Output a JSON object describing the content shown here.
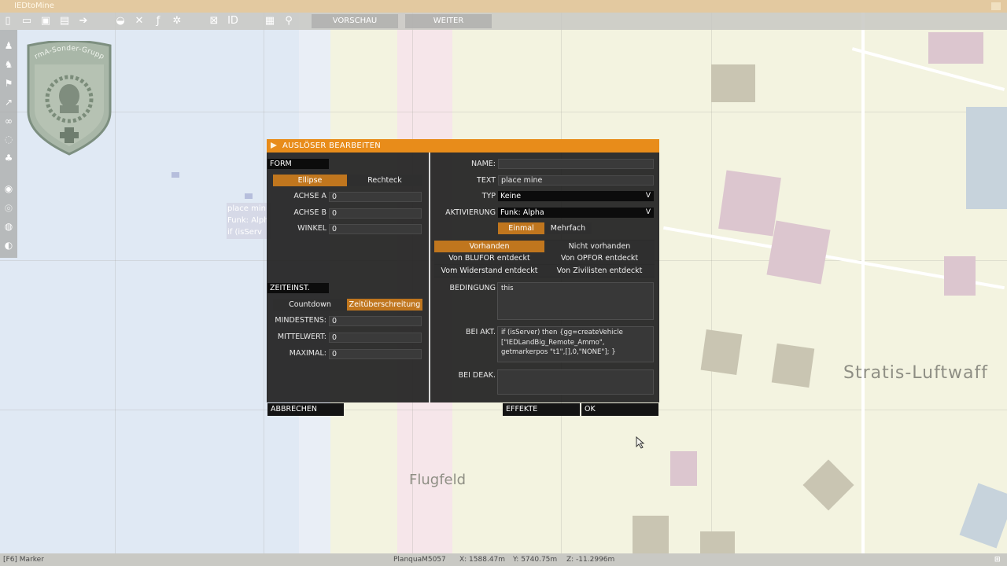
{
  "window": {
    "title": "IEDtoMine"
  },
  "toolbar": {
    "icons": [
      "new-file-icon",
      "open-folder-icon",
      "save-icon",
      "save-as-icon",
      "export-icon",
      "vehicle-icon",
      "tools-icon",
      "function-icon",
      "gear-icon",
      "grid-icon",
      "id-icon",
      "window-icon",
      "link-icon"
    ],
    "preview_label": "VORSCHAU",
    "continue_label": "WEITER"
  },
  "sidebar": {
    "icons": [
      "unit-icon",
      "group-icon",
      "flag-icon",
      "waypoint-icon",
      "link-icon",
      "trigger-icon",
      "vehicle-group-icon",
      "marker-icon",
      "sensor-icon",
      "module-icon",
      "module-alt-icon"
    ]
  },
  "emblem": {
    "text": "ArmA-Sonder-Gruppe"
  },
  "map": {
    "labels": {
      "airfield": "Flugfeld",
      "airbase": "Stratis-Luftwaff"
    },
    "marker_lines": [
      "place min",
      "Funk: Alph",
      "if (isServ"
    ]
  },
  "dialog": {
    "title": "AUSLÖSER BEARBEITEN",
    "form": {
      "section": "FORM",
      "ellipse": "Ellipse",
      "rectangle": "Rechteck",
      "axis_a_label": "ACHSE A",
      "axis_a": "0",
      "axis_b_label": "ACHSE B",
      "axis_b": "0",
      "angle_label": "WINKEL",
      "angle": "0"
    },
    "timer": {
      "section": "ZEITEINST.",
      "countdown": "Countdown",
      "timeout": "Zeitüberschreitung",
      "min_label": "MINDESTENS:",
      "min": "0",
      "mid_label": "MITTELWERT:",
      "mid": "0",
      "max_label": "MAXIMAL:",
      "max": "0"
    },
    "right": {
      "name_label": "NAME:",
      "name": "",
      "text_label": "TEXT",
      "text": "place mine",
      "type_label": "TYP",
      "type": "Keine",
      "activation_label": "AKTIVIERUNG",
      "activation": "Funk: Alpha",
      "once": "Einmal",
      "repeatedly": "Mehrfach",
      "present": "Vorhanden",
      "not_present": "Nicht vorhanden",
      "detected_blufor": "Von BLUFOR entdeckt",
      "detected_opfor": "Von OPFOR entdeckt",
      "detected_resistance": "Vom Widerstand entdeckt",
      "detected_civilians": "Von Zivilisten entdeckt",
      "condition_label": "BEDINGUNG",
      "condition": "this",
      "on_act_label": "BEI AKT.",
      "on_act": "if (isServer) then {gg=createVehicle [\"IEDLandBig_Remote_Ammo\", getmarkerpos \"t1\",[],0,\"NONE\"]; }",
      "on_deact_label": "BEI DEAK.",
      "on_deact": ""
    },
    "buttons": {
      "cancel": "ABBRECHEN",
      "effects": "EFFEKTE",
      "ok": "OK"
    }
  },
  "status": {
    "left": "[F6] Marker",
    "plane": "PlanquaM5057",
    "x": "X: 1588.47m",
    "y": "Y: 5740.75m",
    "z": "Z: -11.2996m"
  },
  "colors": {
    "accent": "#e88c1a",
    "selected": "#c0761e",
    "panel": "#242424"
  }
}
